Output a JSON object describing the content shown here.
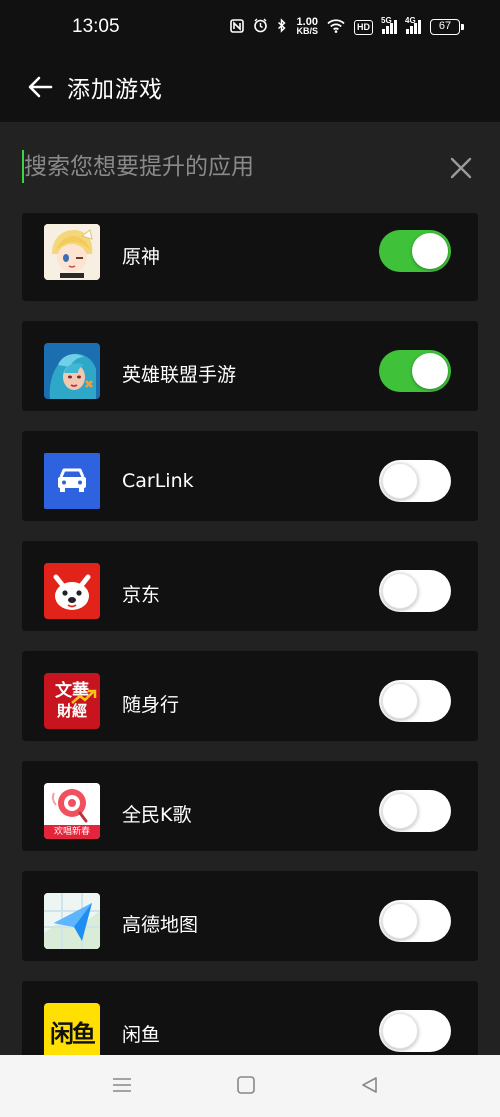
{
  "status_bar": {
    "time": "13:05",
    "net_speed_value": "1.00",
    "net_speed_unit": "KB/S",
    "hd_badge": "HD",
    "signal_labels": [
      "5G",
      "4G"
    ],
    "battery": "67",
    "icons": [
      "nfc-icon",
      "alarm-icon",
      "bluetooth-icon",
      "wifi-icon",
      "hd-icon",
      "signal-5g-icon",
      "signal-4g-icon",
      "battery-icon"
    ]
  },
  "header": {
    "title": "添加游戏",
    "back_icon": "arrow-left-icon"
  },
  "search": {
    "placeholder": "搜索您想要提升的应用",
    "value": "",
    "clear_icon": "close-icon"
  },
  "apps": [
    {
      "name": "原神",
      "icon": "genshin-icon",
      "enabled": true
    },
    {
      "name": "英雄联盟手游",
      "icon": "league-of-legends-icon",
      "enabled": true
    },
    {
      "name": "CarLink",
      "icon": "carlink-icon",
      "enabled": false
    },
    {
      "name": "京东",
      "icon": "jd-icon",
      "enabled": false
    },
    {
      "name": "随身行",
      "icon": "suishenxing-icon",
      "enabled": false,
      "icon_text": [
        "文華",
        "財經"
      ]
    },
    {
      "name": "全民K歌",
      "icon": "kge-icon",
      "enabled": false,
      "icon_text": "欢唱新春"
    },
    {
      "name": "高德地图",
      "icon": "amap-icon",
      "enabled": false
    },
    {
      "name": "闲鱼",
      "icon": "xianyu-icon",
      "enabled": false,
      "icon_text": "闲鱼"
    }
  ],
  "nav_bar": {
    "buttons": [
      "menu-icon",
      "home-square-icon",
      "back-triangle-icon"
    ]
  },
  "colors": {
    "background": "#222222",
    "card": "#111111",
    "toggle_on": "#3fc23a",
    "caret": "#3fd146",
    "nav_bar": "#f5f5f5"
  }
}
